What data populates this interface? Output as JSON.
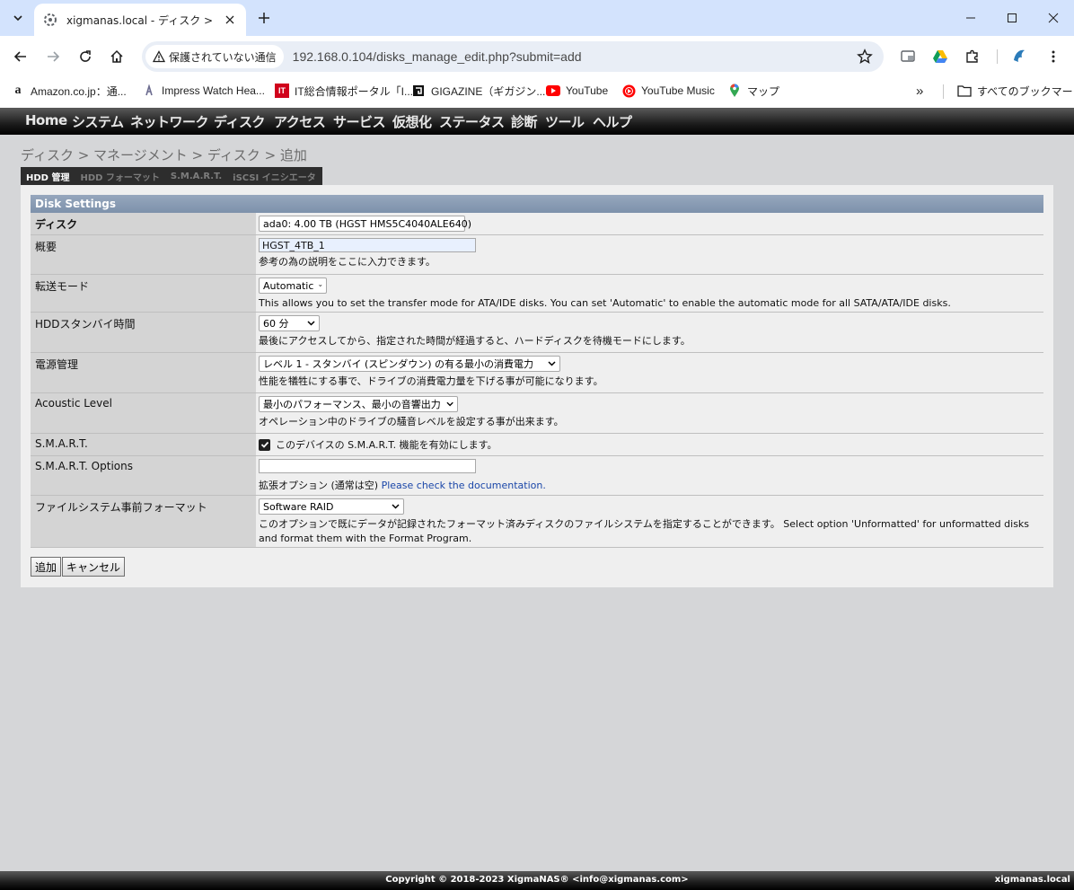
{
  "browser": {
    "tab_title": "xigmanas.local - ディスク > マネー",
    "security_label": "保護されていない通信",
    "url": "192.168.0.104/disks_manage_edit.php?submit=add",
    "bookmarks": [
      {
        "label": "Amazon.co.jp：通...",
        "icon": "amazon-icon"
      },
      {
        "label": "Impress Watch Hea...",
        "icon": "impress-icon"
      },
      {
        "label": "IT総合情報ポータル「I...",
        "icon": "itmedia-icon"
      },
      {
        "label": "GIGAZINE（ギガジン...",
        "icon": "gigazine-icon"
      },
      {
        "label": "YouTube",
        "icon": "youtube-icon"
      },
      {
        "label": "YouTube Music",
        "icon": "youtube-music-icon"
      },
      {
        "label": "マップ",
        "icon": "maps-icon"
      }
    ],
    "all_bookmarks": "すべてのブックマーク",
    "overflow": "»"
  },
  "nav": {
    "items": [
      "Home",
      "システム",
      "ネットワーク",
      "ディスク",
      "アクセス",
      "サービス",
      "仮想化",
      "ステータス",
      "診断",
      "ツール",
      "ヘルプ"
    ]
  },
  "breadcrumb": "ディスク > マネージメント > ディスク > 追加",
  "tabs": [
    {
      "label": "HDD 管理",
      "active": true
    },
    {
      "label": "HDD フォーマット",
      "active": false
    },
    {
      "label": "S.M.A.R.T.",
      "active": false
    },
    {
      "label": "iSCSI イニシエータ",
      "active": false
    }
  ],
  "form": {
    "section_title": "Disk Settings",
    "disk": {
      "label": "ディスク",
      "value": "ada0: 4.00 TB (HGST HMS5C4040ALE640)"
    },
    "description": {
      "label": "概要",
      "value": "HGST_4TB_1",
      "help": "参考の為の説明をここに入力できます。"
    },
    "transfer": {
      "label": "転送モード",
      "value": "Automatic",
      "help": "This allows you to set the transfer mode for ATA/IDE disks. You can set 'Automatic' to enable the automatic mode for all SATA/ATA/IDE disks."
    },
    "standby": {
      "label": "HDDスタンバイ時間",
      "value": "60 分",
      "help": "最後にアクセスしてから、指定された時間が経過すると、ハードディスクを待機モードにします。"
    },
    "power": {
      "label": "電源管理",
      "value": "レベル 1 - スタンバイ (スピンダウン) の有る最小の消費電力",
      "help": "性能を犠牲にする事で、ドライブの消費電力量を下げる事が可能になります。"
    },
    "acoustic": {
      "label": "Acoustic Level",
      "value": "最小のパフォーマンス、最小の音響出力",
      "help": "オペレーション中のドライブの騒音レベルを設定する事が出来ます。"
    },
    "smart": {
      "label": "S.M.A.R.T.",
      "checked": true,
      "checkbox_label": "このデバイスの S.M.A.R.T. 機能を有効にします。"
    },
    "smart_options": {
      "label": "S.M.A.R.T. Options",
      "value": "",
      "help": "拡張オプション (通常は空)",
      "link": "Please check the documentation."
    },
    "preformat": {
      "label": "ファイルシステム事前フォーマット",
      "value": "Software RAID",
      "help": "このオプションで既にデータが記録されたフォーマット済みディスクのファイルシステムを指定することができます。 Select option 'Unformatted' for unformatted disks and format them with the Format Program."
    },
    "add_button": "追加",
    "cancel_button": "キャンセル"
  },
  "footer": {
    "copyright": "Copyright © 2018-2023 XigmaNAS® <info@xigmanas.com>",
    "host": "xigmanas.local"
  },
  "colors": {
    "tabbar": "#d3e3fd",
    "page_bg": "#d5d6d8",
    "section_header": "#8799b2",
    "label_bg": "#d4d4d4",
    "link": "#1a46a8"
  }
}
